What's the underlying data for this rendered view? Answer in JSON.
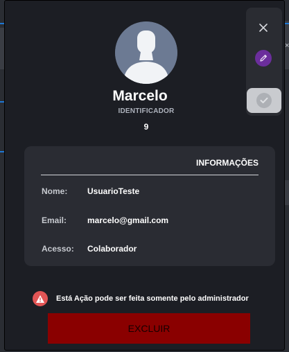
{
  "profile": {
    "name": "Marcelo",
    "identifier_label": "IDENTIFICADOR",
    "identifier_value": "9"
  },
  "actions": {
    "close_icon": "close-icon",
    "edit_icon": "pencil-icon",
    "confirm_icon": "check-icon",
    "edit_color": "#6b2e9c"
  },
  "info": {
    "title": "INFORMAÇÕES",
    "rows": [
      {
        "label": "Nome:",
        "value": "UsuarioTeste"
      },
      {
        "label": "Email:",
        "value": "marcelo@gmail.com"
      },
      {
        "label": "Acesso:",
        "value": "Colaborador"
      }
    ]
  },
  "warning": {
    "icon": "warning-icon",
    "text": "Está Ação pode ser feita somente pelo administrador",
    "color": "#e25555"
  },
  "delete_button": {
    "label": "EXCLUIR",
    "color": "#8a0000"
  },
  "background": {
    "glyph": "×"
  }
}
